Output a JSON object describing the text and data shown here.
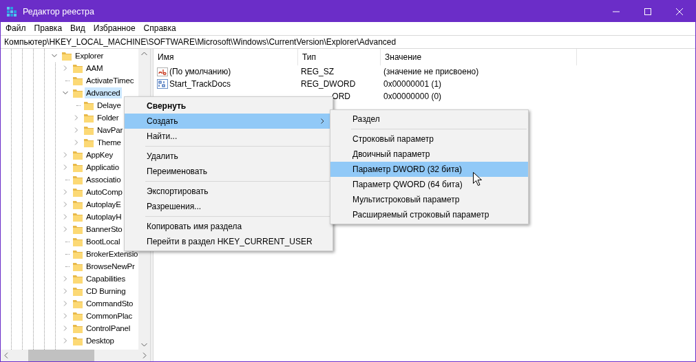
{
  "window": {
    "title": "Редактор реестра"
  },
  "menu_bar": [
    "Файл",
    "Правка",
    "Вид",
    "Избранное",
    "Справка"
  ],
  "address": "Компьютер\\HKEY_LOCAL_MACHINE\\SOFTWARE\\Microsoft\\Windows\\CurrentVersion\\Explorer\\Advanced",
  "tree": [
    {
      "label": "Explorer",
      "has_children": true,
      "expanded": true,
      "selected": false,
      "children": [
        {
          "label": "AAM",
          "has_children": true,
          "expanded": false,
          "selected": false
        },
        {
          "label": "ActivateTimec",
          "has_children": false,
          "expanded": false,
          "selected": false
        },
        {
          "label": "Advanced",
          "has_children": true,
          "expanded": true,
          "selected": true,
          "children": [
            {
              "label": "Delaye",
              "has_children": false,
              "expanded": false,
              "selected": false
            },
            {
              "label": "Folder",
              "has_children": true,
              "expanded": false,
              "selected": false
            },
            {
              "label": "NavPar",
              "has_children": true,
              "expanded": false,
              "selected": false
            },
            {
              "label": "Theme",
              "has_children": true,
              "expanded": false,
              "selected": false
            }
          ]
        },
        {
          "label": "AppKey",
          "has_children": true,
          "expanded": false,
          "selected": false
        },
        {
          "label": "Applicatio",
          "has_children": true,
          "expanded": false,
          "selected": false
        },
        {
          "label": "Associatio",
          "has_children": false,
          "expanded": false,
          "selected": false
        },
        {
          "label": "AutoComp",
          "has_children": true,
          "expanded": false,
          "selected": false
        },
        {
          "label": "AutoplayE",
          "has_children": true,
          "expanded": false,
          "selected": false
        },
        {
          "label": "AutoplayH",
          "has_children": true,
          "expanded": false,
          "selected": false
        },
        {
          "label": "BannerSto",
          "has_children": true,
          "expanded": false,
          "selected": false
        },
        {
          "label": "BootLocal",
          "has_children": false,
          "expanded": false,
          "selected": false
        },
        {
          "label": "BrokerExtensio",
          "has_children": false,
          "expanded": false,
          "selected": false
        },
        {
          "label": "BrowseNewPr",
          "has_children": false,
          "expanded": false,
          "selected": false
        },
        {
          "label": "Capabilities",
          "has_children": true,
          "expanded": false,
          "selected": false
        },
        {
          "label": "CD Burning",
          "has_children": true,
          "expanded": false,
          "selected": false
        },
        {
          "label": "CommandSto",
          "has_children": true,
          "expanded": false,
          "selected": false
        },
        {
          "label": "CommonPlac",
          "has_children": true,
          "expanded": false,
          "selected": false
        },
        {
          "label": "ControlPanel",
          "has_children": true,
          "expanded": false,
          "selected": false
        },
        {
          "label": "Desktop",
          "has_children": true,
          "expanded": false,
          "selected": false
        }
      ]
    }
  ],
  "values": {
    "columns": [
      "Имя",
      "Тип",
      "Значение"
    ],
    "rows": [
      {
        "kind": "string",
        "name": "(По умолчанию)",
        "type": "REG_SZ",
        "value": "(значение не присвоено)"
      },
      {
        "kind": "binary",
        "name": "Start_TrackDocs",
        "type": "REG_DWORD",
        "value": "0x00000001 (1)"
      },
      {
        "type": "ORD",
        "value": "0x00000000 (0)"
      }
    ]
  },
  "context_menu": {
    "items": [
      {
        "kind": "item",
        "label": "Свернуть",
        "default": true,
        "selected": false,
        "submenu": false
      },
      {
        "kind": "item",
        "label": "Создать",
        "default": false,
        "selected": true,
        "submenu": true
      },
      {
        "kind": "item",
        "label": "Найти...",
        "default": false,
        "selected": false,
        "submenu": false
      },
      {
        "kind": "separator"
      },
      {
        "kind": "item",
        "label": "Удалить",
        "default": false,
        "selected": false,
        "submenu": false
      },
      {
        "kind": "item",
        "label": "Переименовать",
        "default": false,
        "selected": false,
        "submenu": false
      },
      {
        "kind": "separator"
      },
      {
        "kind": "item",
        "label": "Экспортировать",
        "default": false,
        "selected": false,
        "submenu": false
      },
      {
        "kind": "item",
        "label": "Разрешения...",
        "default": false,
        "selected": false,
        "submenu": false
      },
      {
        "kind": "separator"
      },
      {
        "kind": "item",
        "label": "Копировать имя раздела",
        "default": false,
        "selected": false,
        "submenu": false
      },
      {
        "kind": "item",
        "label": "Перейти в раздел HKEY_CURRENT_USER",
        "default": false,
        "selected": false,
        "submenu": false
      }
    ]
  },
  "submenu": {
    "items": [
      {
        "kind": "item",
        "label": "Раздел",
        "default": false,
        "selected": false,
        "submenu": false
      },
      {
        "kind": "separator"
      },
      {
        "kind": "item",
        "label": "Строковый параметр",
        "default": false,
        "selected": false,
        "submenu": false
      },
      {
        "kind": "item",
        "label": "Двоичный параметр",
        "default": false,
        "selected": false,
        "submenu": false
      },
      {
        "kind": "item",
        "label": "Параметр DWORD (32 бита)",
        "default": false,
        "selected": true,
        "submenu": false
      },
      {
        "kind": "item",
        "label": "Параметр QWORD (64 бита)",
        "default": false,
        "selected": false,
        "submenu": false
      },
      {
        "kind": "item",
        "label": "Мультистроковый параметр",
        "default": false,
        "selected": false,
        "submenu": false
      },
      {
        "kind": "item",
        "label": "Расширяемый строковый параметр",
        "default": false,
        "selected": false,
        "submenu": false
      }
    ]
  }
}
